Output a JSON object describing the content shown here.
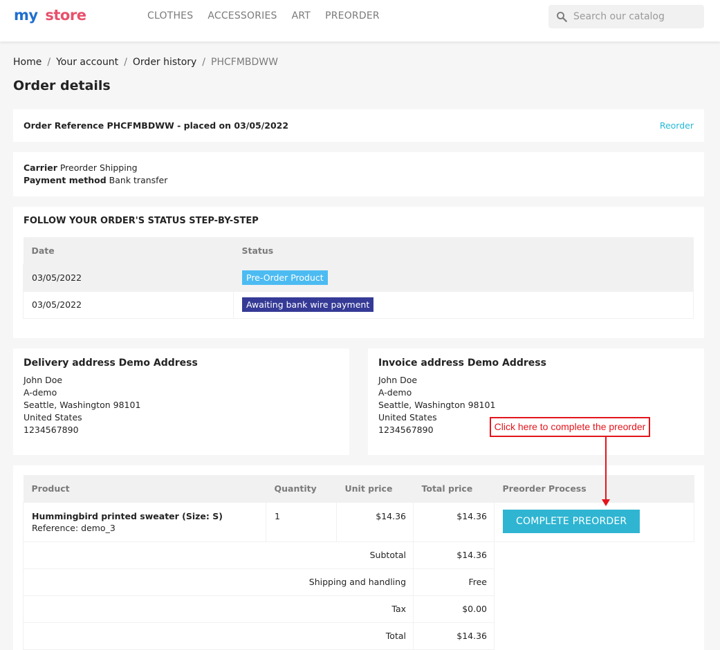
{
  "header": {
    "logo": {
      "word1": "my",
      "word2": "store"
    },
    "nav": [
      "CLOTHES",
      "ACCESSORIES",
      "ART",
      "PREORDER"
    ],
    "search_placeholder": "Search our catalog"
  },
  "breadcrumb": {
    "items": [
      "Home",
      "Your account",
      "Order history"
    ],
    "current": "PHCFMBDWW"
  },
  "page_title": "Order details",
  "order_ref": {
    "text": "Order Reference PHCFMBDWW - placed on 03/05/2022",
    "reorder_label": "Reorder"
  },
  "info": {
    "carrier_label": "Carrier",
    "carrier_value": "Preorder Shipping",
    "payment_label": "Payment method",
    "payment_value": "Bank transfer"
  },
  "status": {
    "title": "FOLLOW YOUR ORDER'S STATUS STEP-BY-STEP",
    "headers": [
      "Date",
      "Status"
    ],
    "rows": [
      {
        "date": "03/05/2022",
        "status": "Pre-Order Product",
        "color": "#4cbbf2"
      },
      {
        "date": "03/05/2022",
        "status": "Awaiting bank wire payment",
        "color": "#353a96"
      }
    ]
  },
  "delivery": {
    "title": "Delivery address Demo Address",
    "lines": [
      "John Doe",
      "A-demo",
      "Seattle, Washington 98101",
      "United States",
      "1234567890"
    ]
  },
  "invoice": {
    "title": "Invoice address Demo Address",
    "lines": [
      "John Doe",
      "A-demo",
      "Seattle, Washington 98101",
      "United States",
      "1234567890"
    ]
  },
  "callout": "Click here to complete the preorder",
  "products": {
    "headers": [
      "Product",
      "Quantity",
      "Unit price",
      "Total price",
      "Preorder Process"
    ],
    "item": {
      "name": "Hummingbird printed sweater (Size: S)",
      "reference": "Reference: demo_3",
      "quantity": "1",
      "unit_price": "$14.36",
      "total_price": "$14.36",
      "button": "COMPLETE PREORDER"
    },
    "totals": [
      {
        "label": "Subtotal",
        "value": "$14.36"
      },
      {
        "label": "Shipping and handling",
        "value": "Free"
      },
      {
        "label": "Tax",
        "value": "$0.00"
      },
      {
        "label": "Total",
        "value": "$14.36"
      }
    ]
  },
  "colors": {
    "accent": "#2fb5d2",
    "callout": "#e3141b"
  }
}
